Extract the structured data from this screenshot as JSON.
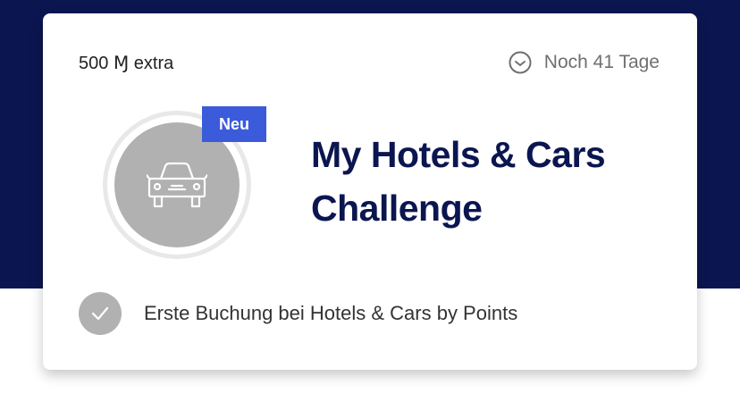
{
  "card": {
    "reward_amount": "500",
    "reward_currency_symbol": "Ɱ",
    "reward_suffix": "extra",
    "deadline": "Noch 41 Tage",
    "badge_icon": "car-icon",
    "new_label": "Neu",
    "title": "My Hotels & Cars Challenge",
    "task": {
      "label": "Erste Buchung bei Hotels & Cars by Points",
      "status_icon": "check-icon",
      "completed": false
    }
  },
  "colors": {
    "navy": "#0b1650",
    "accent_blue": "#3b5bdb",
    "badge_grey": "#b1b1b1",
    "muted_text": "#6f6f6f"
  }
}
